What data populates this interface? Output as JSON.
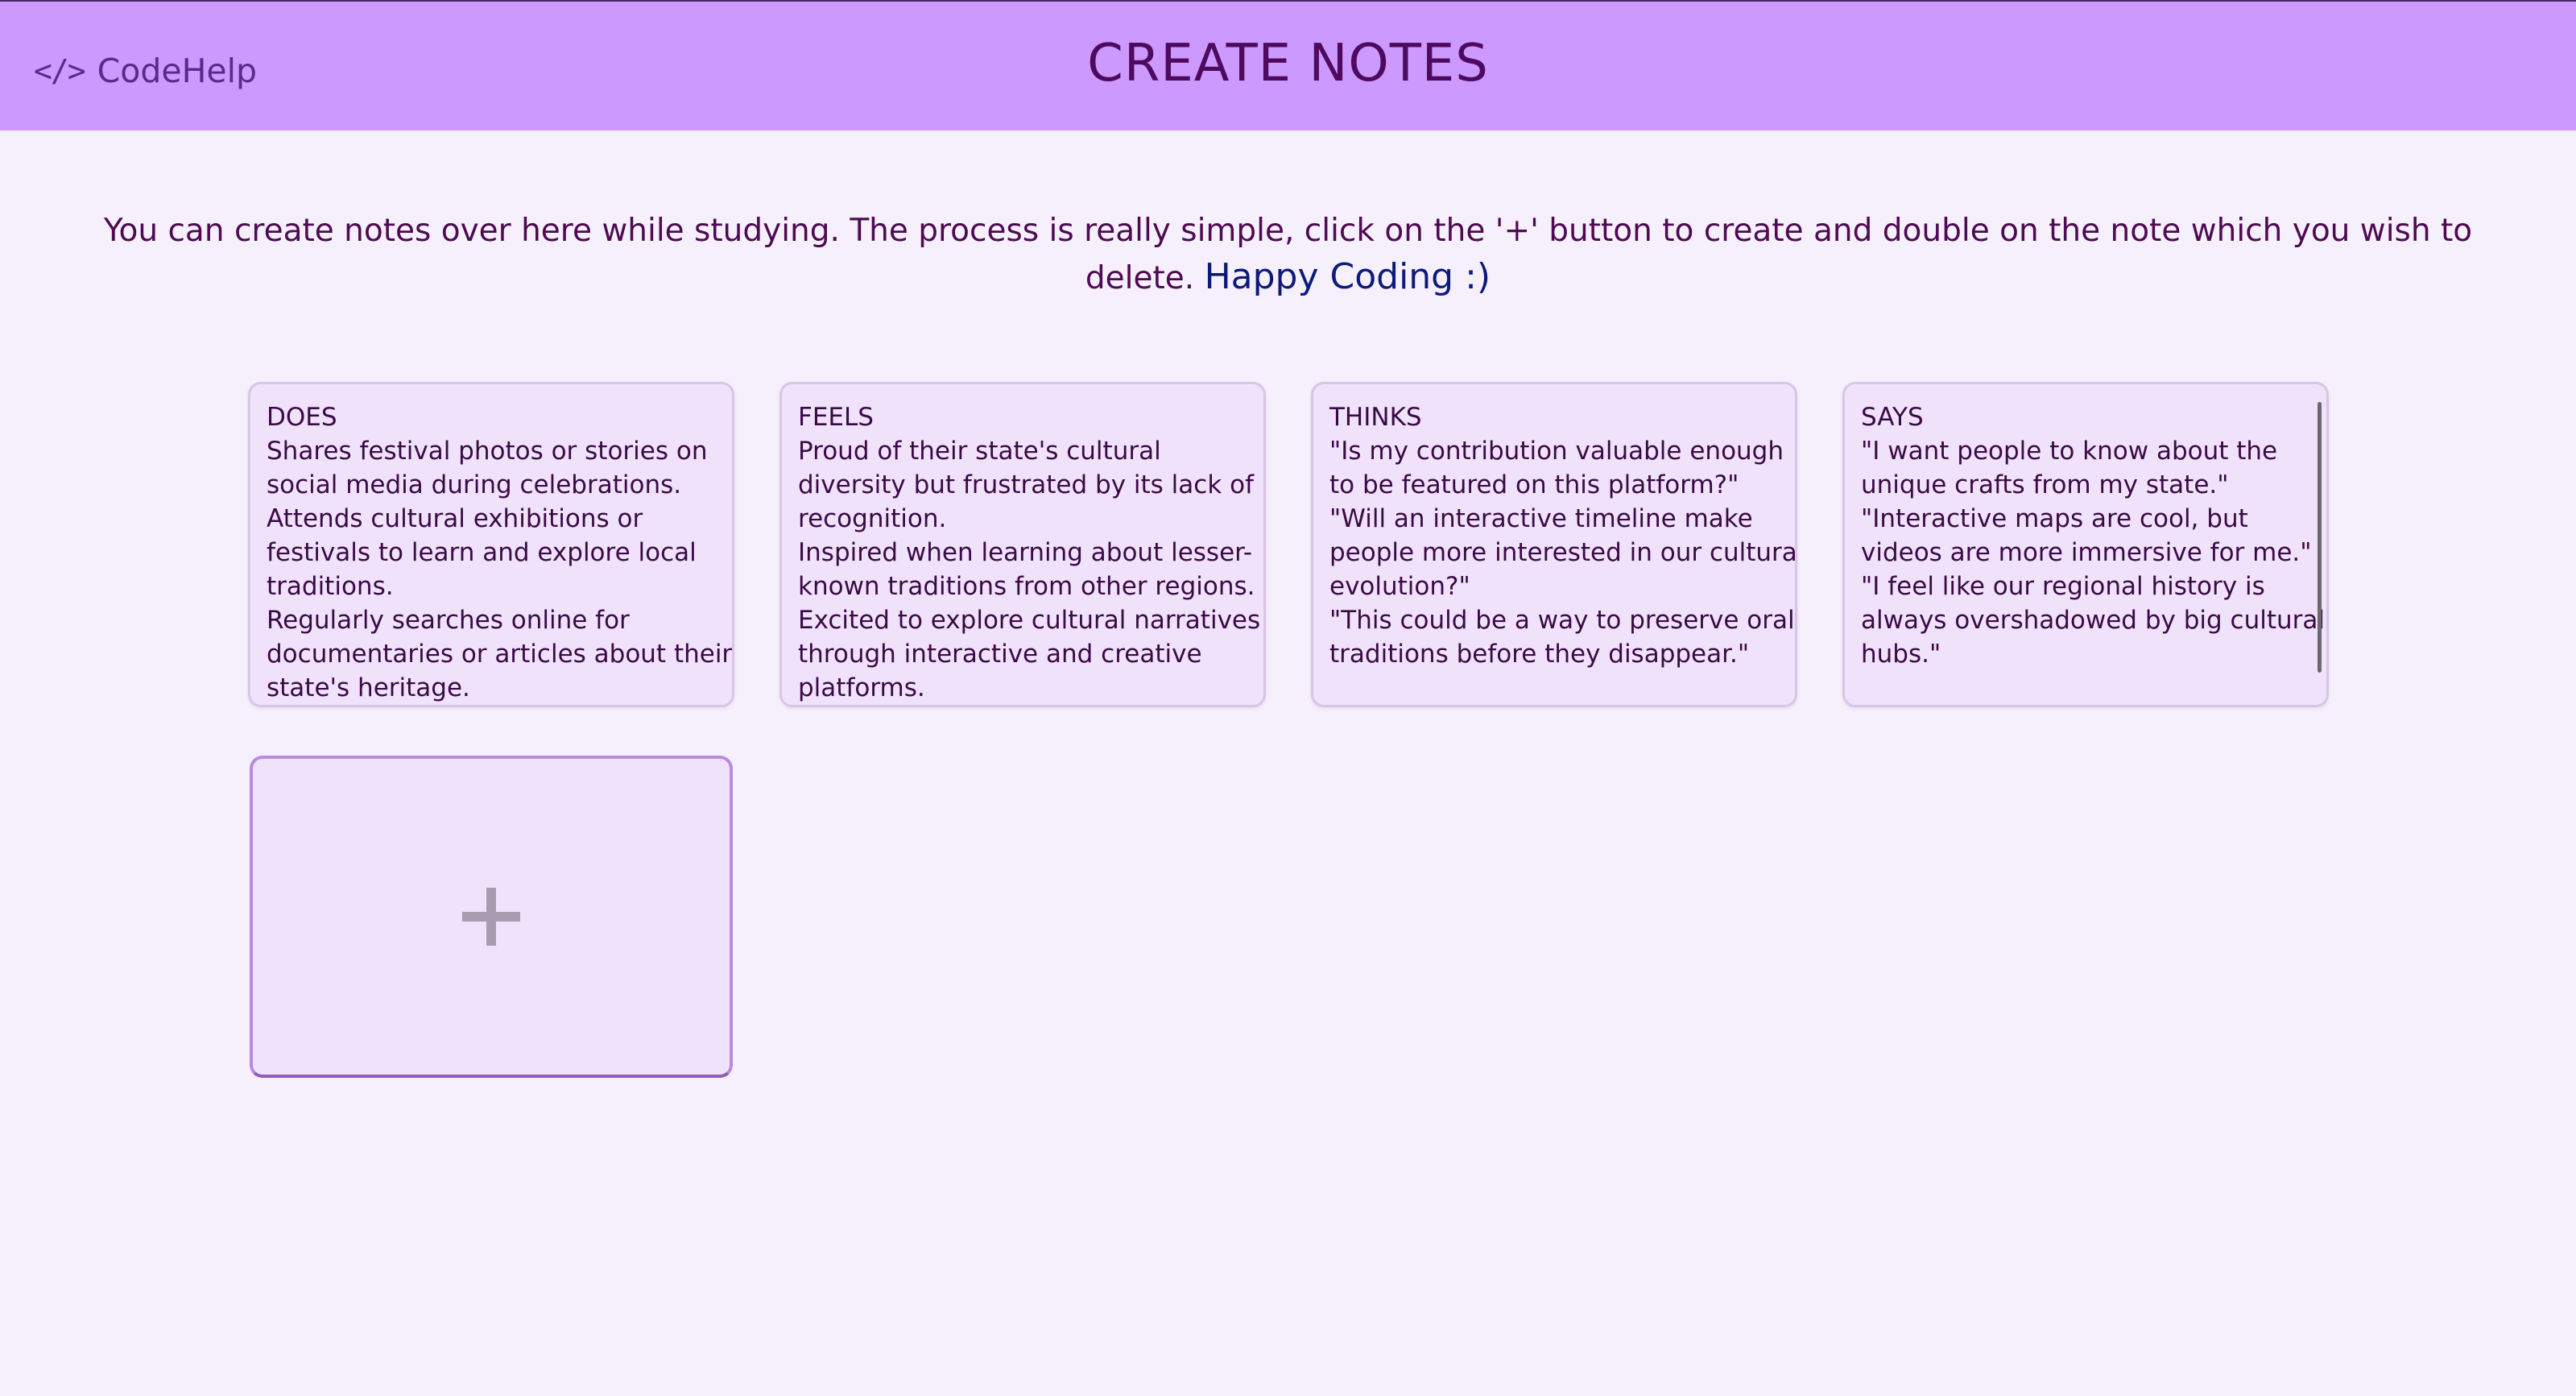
{
  "header": {
    "logo_icon": "</>",
    "logo_text": "CodeHelp",
    "title": "CREATE NOTES",
    "background": "#cc99ff"
  },
  "intro": {
    "text": "You can create notes over here while studying. The process is really simple, click on the '+' button to create and double on the note which you wish to delete.",
    "highlight": "Happy Coding :)"
  },
  "notes": [
    {
      "heading": "DOES",
      "lines": [
        "Shares festival photos or stories on",
        "social media during celebrations.",
        "Attends cultural exhibitions or",
        "festivals to learn and explore local",
        "traditions.",
        "Regularly searches online for",
        "documentaries or articles about their",
        "state's heritage."
      ]
    },
    {
      "heading": "FEELS",
      "lines": [
        "Proud of their state's cultural",
        "diversity but frustrated by its lack of",
        "recognition.",
        "Inspired when learning about lesser-",
        "known traditions from other regions.",
        "Excited to explore cultural narratives",
        "through interactive and creative",
        "platforms."
      ]
    },
    {
      "heading": "THINKS",
      "lines": [
        "\"Is my contribution valuable enough",
        "to be featured on this platform?\"",
        "\"Will an interactive timeline make",
        "people more interested in our cultural",
        "evolution?\"",
        "\"This could be a way to preserve oral",
        "traditions before they disappear.\""
      ]
    },
    {
      "heading": "SAYS",
      "lines": [
        "\"I want people to know about the",
        "unique crafts from my state.\"",
        "\"Interactive maps are cool, but",
        "videos are more immersive for me.\"",
        "\"I feel like our regional history is",
        "always overshadowed by big cultural",
        "hubs.\""
      ]
    }
  ],
  "add_button": {
    "icon": "plus-icon"
  }
}
